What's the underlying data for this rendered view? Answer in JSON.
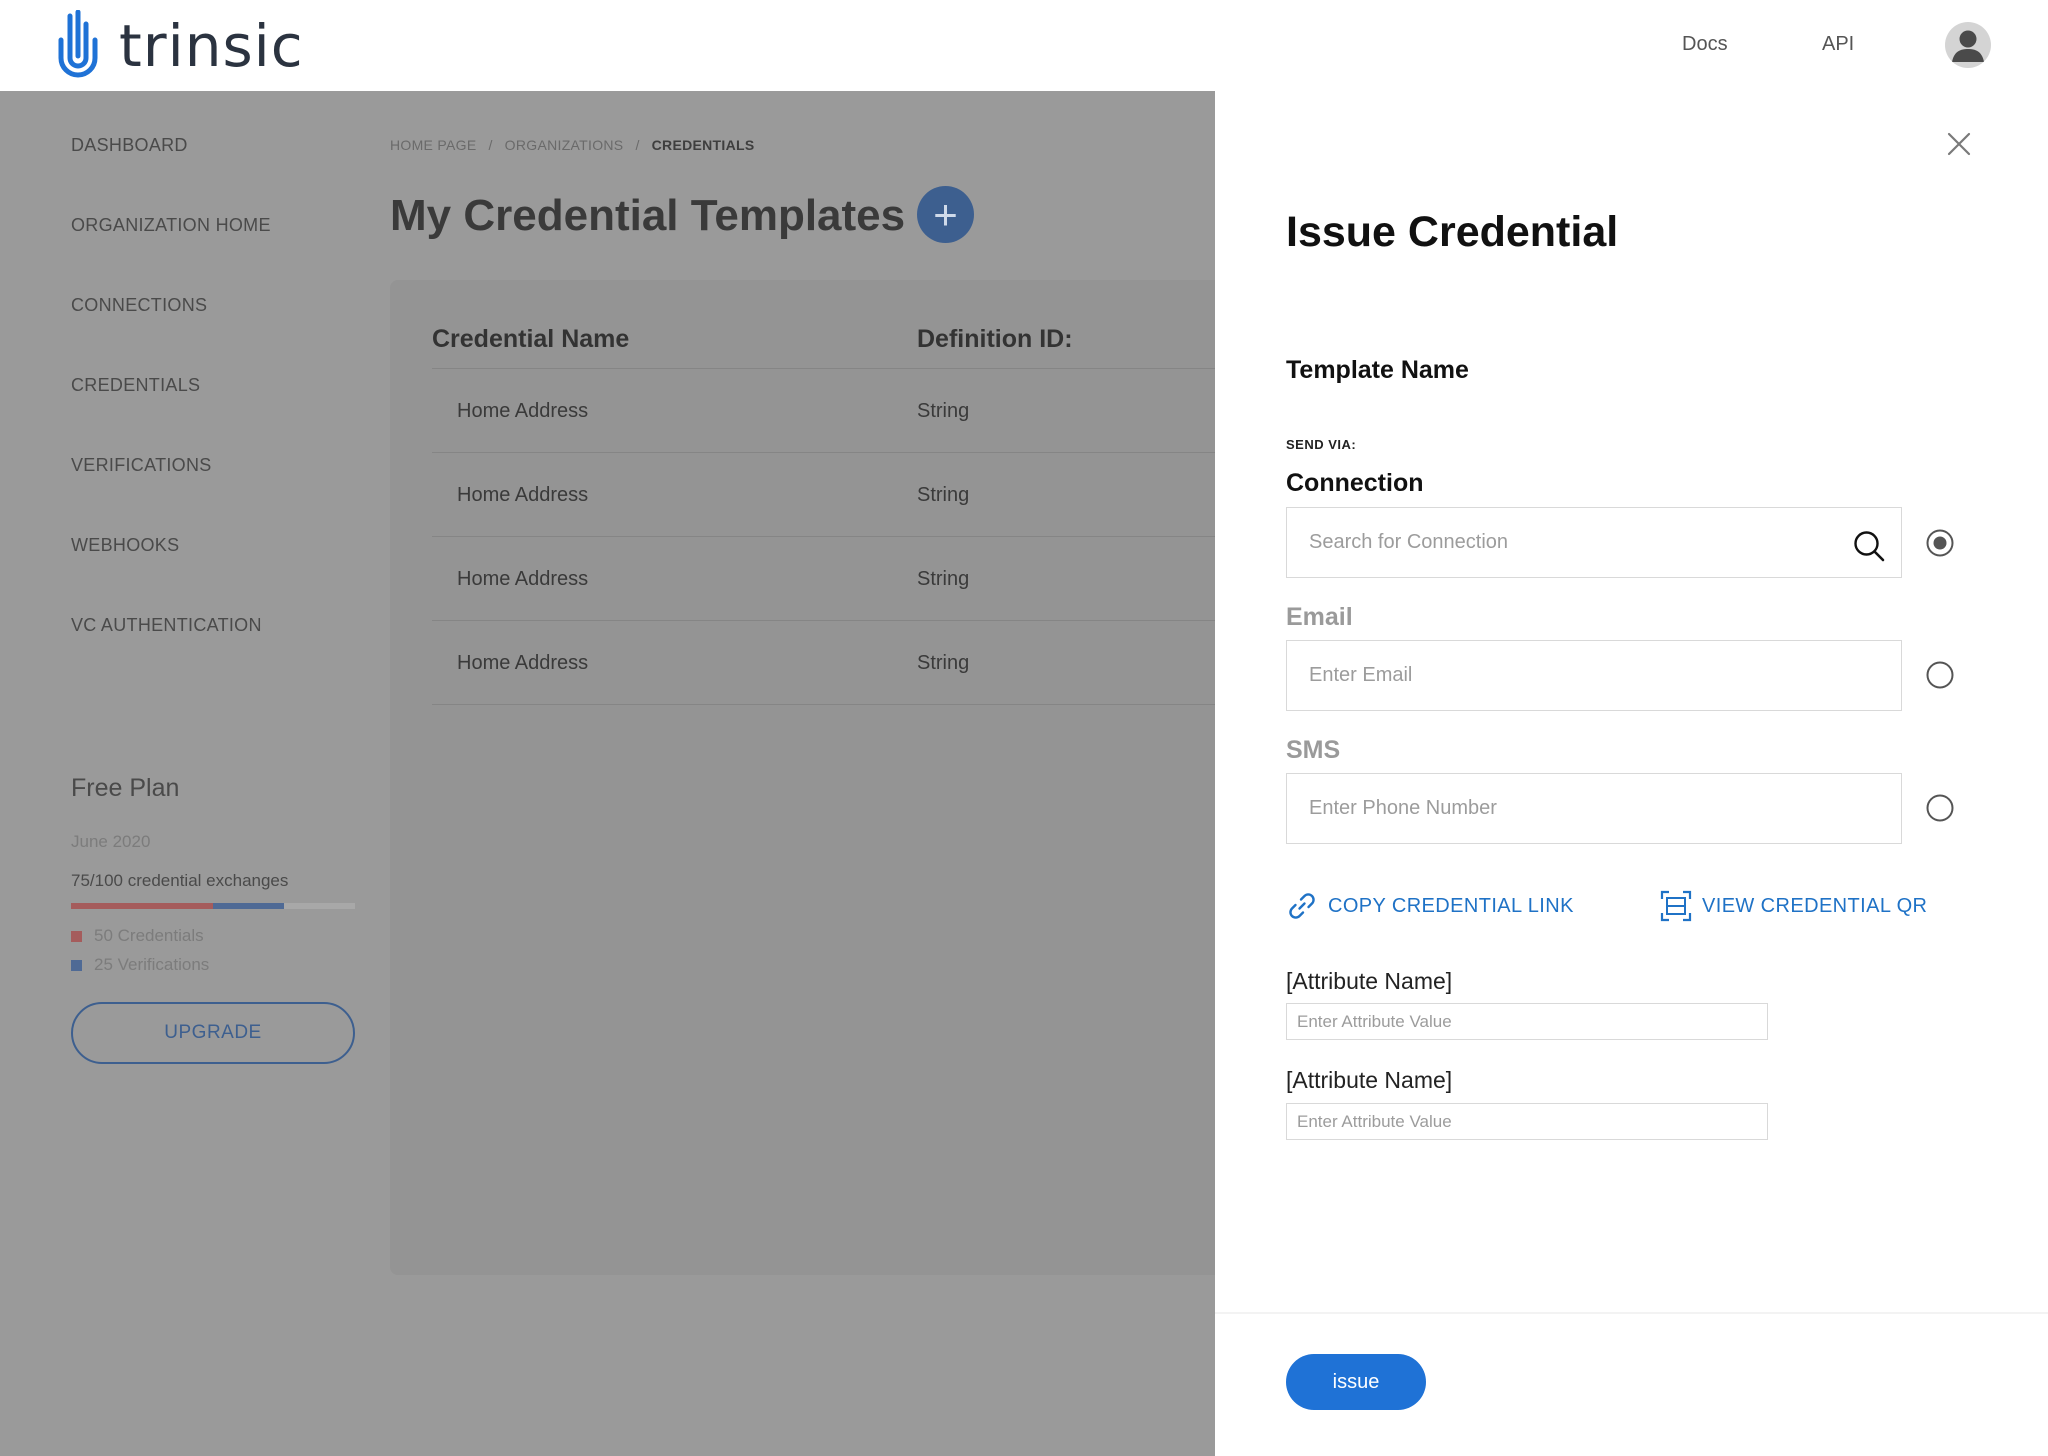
{
  "header": {
    "logo_text": "trinsic",
    "nav_docs": "Docs",
    "nav_api": "API",
    "brand_color": "#1f72d6"
  },
  "sidebar": {
    "items": [
      {
        "label": "DASHBOARD"
      },
      {
        "label": "ORGANIZATION HOME"
      },
      {
        "label": "CONNECTIONS"
      },
      {
        "label": "CREDENTIALS"
      },
      {
        "label": "VERIFICATIONS"
      },
      {
        "label": "WEBHOOKS"
      },
      {
        "label": "VC AUTHENTICATION"
      }
    ],
    "plan": {
      "title": "Free Plan",
      "date": "June 2020",
      "usage": "75/100 credential exchanges",
      "credentials_fraction": 0.5,
      "verifications_fraction": 0.25,
      "legend_credentials": "50 Credentials",
      "legend_verifications": "25 Verifications",
      "upgrade_label": "UPGRADE"
    }
  },
  "main": {
    "breadcrumb": [
      "HOME PAGE",
      "/",
      "ORGANIZATIONS",
      "/",
      "CREDENTIALS"
    ],
    "title": "My Credential Templates",
    "add_symbol": "+",
    "table": {
      "columns": [
        "Credential Name",
        "Definition ID:"
      ],
      "rows": [
        [
          "Home Address",
          "String"
        ],
        [
          "Home Address",
          "String"
        ],
        [
          "Home Address",
          "String"
        ],
        [
          "Home Address",
          "String"
        ]
      ]
    }
  },
  "modal": {
    "title": "Issue Credential",
    "template_name": "Template Name",
    "send_via": "SEND VIA:",
    "connection": {
      "label": "Connection",
      "placeholder": "Search for Connection",
      "selected": true
    },
    "email": {
      "label": "Email",
      "placeholder": "Enter Email",
      "selected": false
    },
    "sms": {
      "label": "SMS",
      "placeholder": "Enter Phone Number",
      "selected": false
    },
    "copy_link": "COPY CREDENTIAL LINK",
    "view_qr": "VIEW CREDENTIAL QR",
    "attributes": [
      {
        "label": "[Attribute Name]",
        "placeholder": "Enter Attribute Value"
      },
      {
        "label": "[Attribute Name]",
        "placeholder": "Enter Attribute Value"
      }
    ],
    "issue_label": "issue"
  }
}
